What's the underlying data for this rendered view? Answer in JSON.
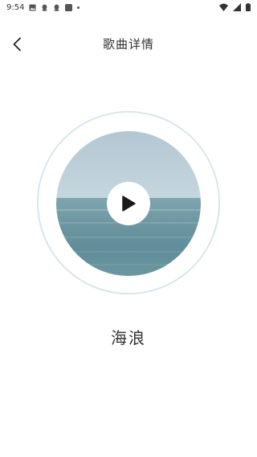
{
  "status_bar": {
    "time": "9:54",
    "left_icons": [
      "image-icon",
      "qq-icon",
      "qq-icon",
      "app-icon",
      "dot-icon"
    ],
    "right_icons": [
      "wifi-icon",
      "signal-icon",
      "battery-icon"
    ]
  },
  "header": {
    "back_icon": "chevron-left-icon",
    "title": "歌曲详情"
  },
  "player": {
    "play_icon": "play-icon",
    "song_title": "海浪"
  },
  "colors": {
    "ring": "#d9e6ec",
    "play_triangle": "#1a1a1a",
    "sky": "#b3c7d3",
    "sea": "#6a949f"
  }
}
